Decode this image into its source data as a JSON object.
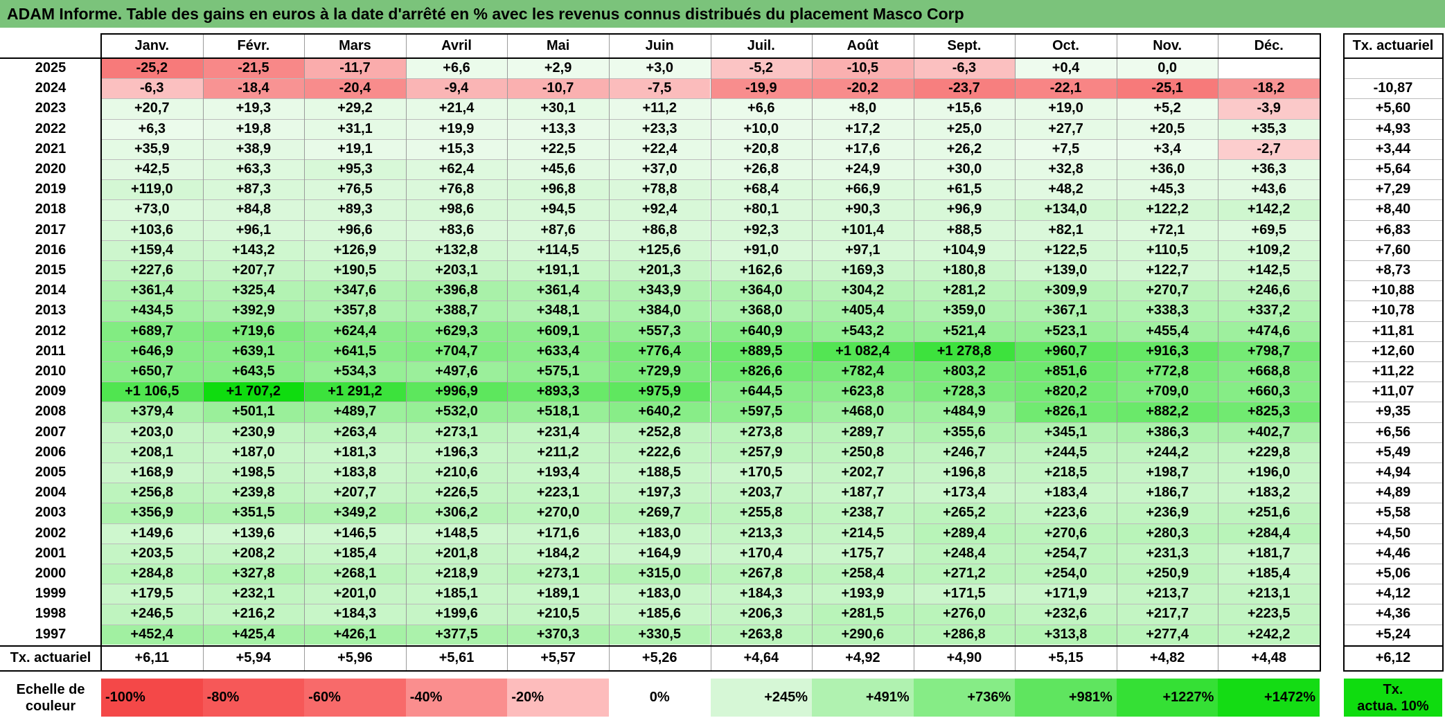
{
  "title": "ADAM Informe. Table des gains en euros à la date d'arrêté en % avec les revenus connus distribués du placement Masco Corp",
  "colors": {
    "title_bg": "#7bc37b",
    "neg_strong": "#f44848",
    "neg_light": "#fde4e4",
    "pos_light": "#eefbee",
    "pos_strong": "#0fdc0f",
    "actuarial_box": "#0fdc0f"
  },
  "chart_data": {
    "type": "heatmap",
    "columns": [
      "Janv.",
      "Févr.",
      "Mars",
      "Avril",
      "Mai",
      "Juin",
      "Juil.",
      "Août",
      "Sept.",
      "Oct.",
      "Nov.",
      "Déc."
    ],
    "side_header": "Tx. actuariel",
    "rows": [
      {
        "year": "2025",
        "values": [
          -25.2,
          -21.5,
          -11.7,
          6.6,
          2.9,
          3.0,
          -5.2,
          -10.5,
          -6.3,
          0.4,
          0.0,
          null
        ],
        "labels": [
          "-25,2",
          "-21,5",
          "-11,7",
          "+6,6",
          "+2,9",
          "+3,0",
          "-5,2",
          "-10,5",
          "-6,3",
          "+0,4",
          "0,0",
          ""
        ],
        "rate": ""
      },
      {
        "year": "2024",
        "values": [
          -6.3,
          -18.4,
          -20.4,
          -9.4,
          -10.7,
          -7.5,
          -19.9,
          -20.2,
          -23.7,
          -22.1,
          -25.1,
          -18.2
        ],
        "labels": [
          "-6,3",
          "-18,4",
          "-20,4",
          "-9,4",
          "-10,7",
          "-7,5",
          "-19,9",
          "-20,2",
          "-23,7",
          "-22,1",
          "-25,1",
          "-18,2"
        ],
        "rate": "-10,87"
      },
      {
        "year": "2023",
        "values": [
          20.7,
          19.3,
          29.2,
          21.4,
          30.1,
          11.2,
          6.6,
          8.0,
          15.6,
          19.0,
          5.2,
          -3.9
        ],
        "labels": [
          "+20,7",
          "+19,3",
          "+29,2",
          "+21,4",
          "+30,1",
          "+11,2",
          "+6,6",
          "+8,0",
          "+15,6",
          "+19,0",
          "+5,2",
          "-3,9"
        ],
        "rate": "+5,60"
      },
      {
        "year": "2022",
        "values": [
          6.3,
          19.8,
          31.1,
          19.9,
          13.3,
          23.3,
          10.0,
          17.2,
          25.0,
          27.7,
          20.5,
          35.3
        ],
        "labels": [
          "+6,3",
          "+19,8",
          "+31,1",
          "+19,9",
          "+13,3",
          "+23,3",
          "+10,0",
          "+17,2",
          "+25,0",
          "+27,7",
          "+20,5",
          "+35,3"
        ],
        "rate": "+4,93"
      },
      {
        "year": "2021",
        "values": [
          35.9,
          38.9,
          19.1,
          15.3,
          22.5,
          22.4,
          20.8,
          17.6,
          26.2,
          7.5,
          3.4,
          -2.7
        ],
        "labels": [
          "+35,9",
          "+38,9",
          "+19,1",
          "+15,3",
          "+22,5",
          "+22,4",
          "+20,8",
          "+17,6",
          "+26,2",
          "+7,5",
          "+3,4",
          "-2,7"
        ],
        "rate": "+3,44"
      },
      {
        "year": "2020",
        "values": [
          42.5,
          63.3,
          95.3,
          62.4,
          45.6,
          37.0,
          26.8,
          24.9,
          30.0,
          32.8,
          36.0,
          36.3
        ],
        "labels": [
          "+42,5",
          "+63,3",
          "+95,3",
          "+62,4",
          "+45,6",
          "+37,0",
          "+26,8",
          "+24,9",
          "+30,0",
          "+32,8",
          "+36,0",
          "+36,3"
        ],
        "rate": "+5,64"
      },
      {
        "year": "2019",
        "values": [
          119.0,
          87.3,
          76.5,
          76.8,
          96.8,
          78.8,
          68.4,
          66.9,
          61.5,
          48.2,
          45.3,
          43.6
        ],
        "labels": [
          "+119,0",
          "+87,3",
          "+76,5",
          "+76,8",
          "+96,8",
          "+78,8",
          "+68,4",
          "+66,9",
          "+61,5",
          "+48,2",
          "+45,3",
          "+43,6"
        ],
        "rate": "+7,29"
      },
      {
        "year": "2018",
        "values": [
          73.0,
          84.8,
          89.3,
          98.6,
          94.5,
          92.4,
          80.1,
          90.3,
          96.9,
          134.0,
          122.2,
          142.2
        ],
        "labels": [
          "+73,0",
          "+84,8",
          "+89,3",
          "+98,6",
          "+94,5",
          "+92,4",
          "+80,1",
          "+90,3",
          "+96,9",
          "+134,0",
          "+122,2",
          "+142,2"
        ],
        "rate": "+8,40"
      },
      {
        "year": "2017",
        "values": [
          103.6,
          96.1,
          96.6,
          83.6,
          87.6,
          86.8,
          92.3,
          101.4,
          88.5,
          82.1,
          72.1,
          69.5
        ],
        "labels": [
          "+103,6",
          "+96,1",
          "+96,6",
          "+83,6",
          "+87,6",
          "+86,8",
          "+92,3",
          "+101,4",
          "+88,5",
          "+82,1",
          "+72,1",
          "+69,5"
        ],
        "rate": "+6,83"
      },
      {
        "year": "2016",
        "values": [
          159.4,
          143.2,
          126.9,
          132.8,
          114.5,
          125.6,
          91.0,
          97.1,
          104.9,
          122.5,
          110.5,
          109.2
        ],
        "labels": [
          "+159,4",
          "+143,2",
          "+126,9",
          "+132,8",
          "+114,5",
          "+125,6",
          "+91,0",
          "+97,1",
          "+104,9",
          "+122,5",
          "+110,5",
          "+109,2"
        ],
        "rate": "+7,60"
      },
      {
        "year": "2015",
        "values": [
          227.6,
          207.7,
          190.5,
          203.1,
          191.1,
          201.3,
          162.6,
          169.3,
          180.8,
          139.0,
          122.7,
          142.5
        ],
        "labels": [
          "+227,6",
          "+207,7",
          "+190,5",
          "+203,1",
          "+191,1",
          "+201,3",
          "+162,6",
          "+169,3",
          "+180,8",
          "+139,0",
          "+122,7",
          "+142,5"
        ],
        "rate": "+8,73"
      },
      {
        "year": "2014",
        "values": [
          361.4,
          325.4,
          347.6,
          396.8,
          361.4,
          343.9,
          364.0,
          304.2,
          281.2,
          309.9,
          270.7,
          246.6
        ],
        "labels": [
          "+361,4",
          "+325,4",
          "+347,6",
          "+396,8",
          "+361,4",
          "+343,9",
          "+364,0",
          "+304,2",
          "+281,2",
          "+309,9",
          "+270,7",
          "+246,6"
        ],
        "rate": "+10,88"
      },
      {
        "year": "2013",
        "values": [
          434.5,
          392.9,
          357.8,
          388.7,
          348.1,
          384.0,
          368.0,
          405.4,
          359.0,
          367.1,
          338.3,
          337.2
        ],
        "labels": [
          "+434,5",
          "+392,9",
          "+357,8",
          "+388,7",
          "+348,1",
          "+384,0",
          "+368,0",
          "+405,4",
          "+359,0",
          "+367,1",
          "+338,3",
          "+337,2"
        ],
        "rate": "+10,78"
      },
      {
        "year": "2012",
        "values": [
          689.7,
          719.6,
          624.4,
          629.3,
          609.1,
          557.3,
          640.9,
          543.2,
          521.4,
          523.1,
          455.4,
          474.6
        ],
        "labels": [
          "+689,7",
          "+719,6",
          "+624,4",
          "+629,3",
          "+609,1",
          "+557,3",
          "+640,9",
          "+543,2",
          "+521,4",
          "+523,1",
          "+455,4",
          "+474,6"
        ],
        "rate": "+11,81"
      },
      {
        "year": "2011",
        "values": [
          646.9,
          639.1,
          641.5,
          704.7,
          633.4,
          776.4,
          889.5,
          1082.4,
          1278.8,
          960.7,
          916.3,
          798.7
        ],
        "labels": [
          "+646,9",
          "+639,1",
          "+641,5",
          "+704,7",
          "+633,4",
          "+776,4",
          "+889,5",
          "+1 082,4",
          "+1 278,8",
          "+960,7",
          "+916,3",
          "+798,7"
        ],
        "rate": "+12,60"
      },
      {
        "year": "2010",
        "values": [
          650.7,
          643.5,
          534.3,
          497.6,
          575.1,
          729.9,
          826.6,
          782.4,
          803.2,
          851.6,
          772.8,
          668.8
        ],
        "labels": [
          "+650,7",
          "+643,5",
          "+534,3",
          "+497,6",
          "+575,1",
          "+729,9",
          "+826,6",
          "+782,4",
          "+803,2",
          "+851,6",
          "+772,8",
          "+668,8"
        ],
        "rate": "+11,22"
      },
      {
        "year": "2009",
        "values": [
          1106.5,
          1707.2,
          1291.2,
          996.9,
          893.3,
          975.9,
          644.5,
          623.8,
          728.3,
          820.2,
          709.0,
          660.3
        ],
        "labels": [
          "+1 106,5",
          "+1 707,2",
          "+1 291,2",
          "+996,9",
          "+893,3",
          "+975,9",
          "+644,5",
          "+623,8",
          "+728,3",
          "+820,2",
          "+709,0",
          "+660,3"
        ],
        "rate": "+11,07"
      },
      {
        "year": "2008",
        "values": [
          379.4,
          501.1,
          489.7,
          532.0,
          518.1,
          640.2,
          597.5,
          468.0,
          484.9,
          826.1,
          882.2,
          825.3
        ],
        "labels": [
          "+379,4",
          "+501,1",
          "+489,7",
          "+532,0",
          "+518,1",
          "+640,2",
          "+597,5",
          "+468,0",
          "+484,9",
          "+826,1",
          "+882,2",
          "+825,3"
        ],
        "rate": "+9,35"
      },
      {
        "year": "2007",
        "values": [
          203.0,
          230.9,
          263.4,
          273.1,
          231.4,
          252.8,
          273.8,
          289.7,
          355.6,
          345.1,
          386.3,
          402.7
        ],
        "labels": [
          "+203,0",
          "+230,9",
          "+263,4",
          "+273,1",
          "+231,4",
          "+252,8",
          "+273,8",
          "+289,7",
          "+355,6",
          "+345,1",
          "+386,3",
          "+402,7"
        ],
        "rate": "+6,56"
      },
      {
        "year": "2006",
        "values": [
          208.1,
          187.0,
          181.3,
          196.3,
          211.2,
          222.6,
          257.9,
          250.8,
          246.7,
          244.5,
          244.2,
          229.8
        ],
        "labels": [
          "+208,1",
          "+187,0",
          "+181,3",
          "+196,3",
          "+211,2",
          "+222,6",
          "+257,9",
          "+250,8",
          "+246,7",
          "+244,5",
          "+244,2",
          "+229,8"
        ],
        "rate": "+5,49"
      },
      {
        "year": "2005",
        "values": [
          168.9,
          198.5,
          183.8,
          210.6,
          193.4,
          188.5,
          170.5,
          202.7,
          196.8,
          218.5,
          198.7,
          196.0
        ],
        "labels": [
          "+168,9",
          "+198,5",
          "+183,8",
          "+210,6",
          "+193,4",
          "+188,5",
          "+170,5",
          "+202,7",
          "+196,8",
          "+218,5",
          "+198,7",
          "+196,0"
        ],
        "rate": "+4,94"
      },
      {
        "year": "2004",
        "values": [
          256.8,
          239.8,
          207.7,
          226.5,
          223.1,
          197.3,
          203.7,
          187.7,
          173.4,
          183.4,
          186.7,
          183.2
        ],
        "labels": [
          "+256,8",
          "+239,8",
          "+207,7",
          "+226,5",
          "+223,1",
          "+197,3",
          "+203,7",
          "+187,7",
          "+173,4",
          "+183,4",
          "+186,7",
          "+183,2"
        ],
        "rate": "+4,89"
      },
      {
        "year": "2003",
        "values": [
          356.9,
          351.5,
          349.2,
          306.2,
          270.0,
          269.7,
          255.8,
          238.7,
          265.2,
          223.6,
          236.9,
          251.6
        ],
        "labels": [
          "+356,9",
          "+351,5",
          "+349,2",
          "+306,2",
          "+270,0",
          "+269,7",
          "+255,8",
          "+238,7",
          "+265,2",
          "+223,6",
          "+236,9",
          "+251,6"
        ],
        "rate": "+5,58"
      },
      {
        "year": "2002",
        "values": [
          149.6,
          139.6,
          146.5,
          148.5,
          171.6,
          183.0,
          213.3,
          214.5,
          289.4,
          270.6,
          280.3,
          284.4
        ],
        "labels": [
          "+149,6",
          "+139,6",
          "+146,5",
          "+148,5",
          "+171,6",
          "+183,0",
          "+213,3",
          "+214,5",
          "+289,4",
          "+270,6",
          "+280,3",
          "+284,4"
        ],
        "rate": "+4,50"
      },
      {
        "year": "2001",
        "values": [
          203.5,
          208.2,
          185.4,
          201.8,
          184.2,
          164.9,
          170.4,
          175.7,
          248.4,
          254.7,
          231.3,
          181.7
        ],
        "labels": [
          "+203,5",
          "+208,2",
          "+185,4",
          "+201,8",
          "+184,2",
          "+164,9",
          "+170,4",
          "+175,7",
          "+248,4",
          "+254,7",
          "+231,3",
          "+181,7"
        ],
        "rate": "+4,46"
      },
      {
        "year": "2000",
        "values": [
          284.8,
          327.8,
          268.1,
          218.9,
          273.1,
          315.0,
          267.8,
          258.4,
          271.2,
          254.0,
          250.9,
          185.4
        ],
        "labels": [
          "+284,8",
          "+327,8",
          "+268,1",
          "+218,9",
          "+273,1",
          "+315,0",
          "+267,8",
          "+258,4",
          "+271,2",
          "+254,0",
          "+250,9",
          "+185,4"
        ],
        "rate": "+5,06"
      },
      {
        "year": "1999",
        "values": [
          179.5,
          232.1,
          201.0,
          185.1,
          189.1,
          183.0,
          184.3,
          193.9,
          171.5,
          171.9,
          213.7,
          213.1
        ],
        "labels": [
          "+179,5",
          "+232,1",
          "+201,0",
          "+185,1",
          "+189,1",
          "+183,0",
          "+184,3",
          "+193,9",
          "+171,5",
          "+171,9",
          "+213,7",
          "+213,1"
        ],
        "rate": "+4,12"
      },
      {
        "year": "1998",
        "values": [
          246.5,
          216.2,
          184.3,
          199.6,
          210.5,
          185.6,
          206.3,
          281.5,
          276.0,
          232.6,
          217.7,
          223.5
        ],
        "labels": [
          "+246,5",
          "+216,2",
          "+184,3",
          "+199,6",
          "+210,5",
          "+185,6",
          "+206,3",
          "+281,5",
          "+276,0",
          "+232,6",
          "+217,7",
          "+223,5"
        ],
        "rate": "+4,36"
      },
      {
        "year": "1997",
        "values": [
          452.4,
          425.4,
          426.1,
          377.5,
          370.3,
          330.5,
          263.8,
          290.6,
          286.8,
          313.8,
          277.4,
          242.2
        ],
        "labels": [
          "+452,4",
          "+425,4",
          "+426,1",
          "+377,5",
          "+370,3",
          "+330,5",
          "+263,8",
          "+290,6",
          "+286,8",
          "+313,8",
          "+277,4",
          "+242,2"
        ],
        "rate": "+5,24"
      }
    ],
    "footer": {
      "label": "Tx. actuariel",
      "values": [
        "+6,11",
        "+5,94",
        "+5,96",
        "+5,61",
        "+5,57",
        "+5,26",
        "+4,64",
        "+4,92",
        "+4,90",
        "+5,15",
        "+4,82",
        "+4,48"
      ],
      "total": "+6,12"
    },
    "scale": {
      "label_line1": "Echelle de",
      "label_line2": "couleur",
      "steps": [
        {
          "label": "-100%",
          "value": -100,
          "color": "#f44848",
          "align": "left"
        },
        {
          "label": "-80%",
          "value": -80,
          "color": "#f65858",
          "align": "left"
        },
        {
          "label": "-60%",
          "value": -60,
          "color": "#f86a6a",
          "align": "left"
        },
        {
          "label": "-40%",
          "value": -40,
          "color": "#fa8e8e",
          "align": "left"
        },
        {
          "label": "-20%",
          "value": -20,
          "color": "#fdbcbc",
          "align": "left"
        },
        {
          "label": "0%",
          "value": 0,
          "color": "#ffffff",
          "align": "center"
        },
        {
          "label": "+245%",
          "value": 245,
          "color": "#d6f7d6",
          "align": "right"
        },
        {
          "label": "+491%",
          "value": 491,
          "color": "#b0f2b0",
          "align": "right"
        },
        {
          "label": "+736%",
          "value": 736,
          "color": "#86ec86",
          "align": "right"
        },
        {
          "label": "+981%",
          "value": 981,
          "color": "#5fe55f",
          "align": "right"
        },
        {
          "label": "+1227%",
          "value": 1227,
          "color": "#35e035",
          "align": "right"
        },
        {
          "label": "+1472%",
          "value": 1472,
          "color": "#14dc14",
          "align": "right"
        }
      ],
      "actuarial_line1": "Tx.",
      "actuarial_line2": "actua. 10%"
    }
  }
}
